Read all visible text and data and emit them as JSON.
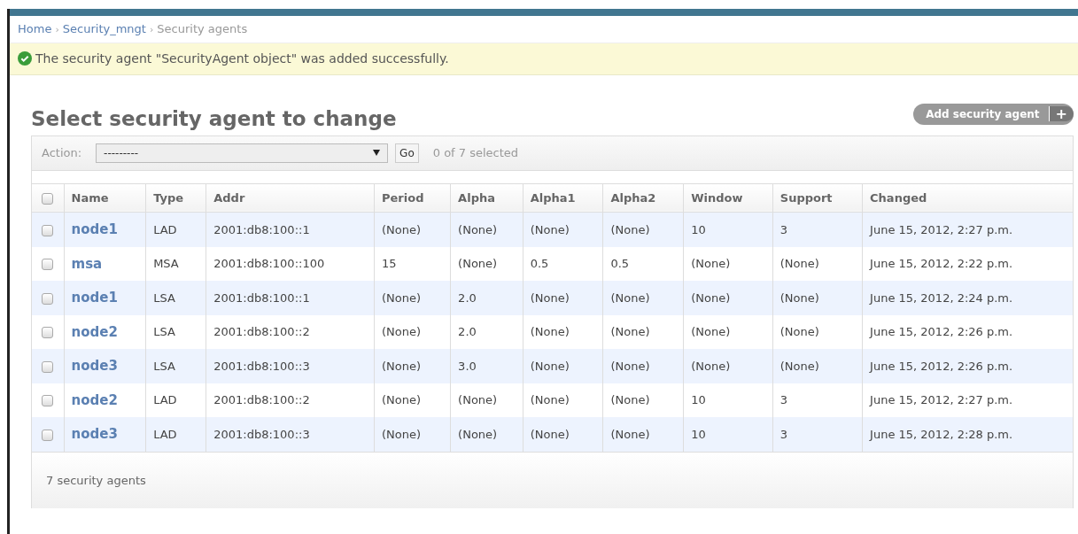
{
  "breadcrumbs": [
    {
      "label": "Home",
      "link": true
    },
    {
      "label": "Security_mngt",
      "link": true
    },
    {
      "label": "Security agents",
      "link": false
    }
  ],
  "breadcrumb_separator": "›",
  "message": {
    "kind": "success",
    "text": "The security agent \"SecurityAgent object\" was added successfully."
  },
  "title": "Select security agent to change",
  "add_button": {
    "label": "Add security agent",
    "icon": "+"
  },
  "actions": {
    "label": "Action:",
    "value": "---------",
    "go": "Go",
    "counter": "0 of 7 selected"
  },
  "table": {
    "select_all_checked": false,
    "columns": [
      "Name",
      "Type",
      "Addr",
      "Period",
      "Alpha",
      "Alpha1",
      "Alpha2",
      "Window",
      "Support",
      "Changed"
    ],
    "rows": [
      {
        "selected": false,
        "cells": [
          "node1",
          "LAD",
          "2001:db8:100::1",
          "(None)",
          "(None)",
          "(None)",
          "(None)",
          "10",
          "3",
          "June 15, 2012, 2:27 p.m."
        ]
      },
      {
        "selected": false,
        "cells": [
          "msa",
          "MSA",
          "2001:db8:100::100",
          "15",
          "(None)",
          "0.5",
          "0.5",
          "(None)",
          "(None)",
          "June 15, 2012, 2:22 p.m."
        ]
      },
      {
        "selected": false,
        "cells": [
          "node1",
          "LSA",
          "2001:db8:100::1",
          "(None)",
          "2.0",
          "(None)",
          "(None)",
          "(None)",
          "(None)",
          "June 15, 2012, 2:24 p.m."
        ]
      },
      {
        "selected": false,
        "cells": [
          "node2",
          "LSA",
          "2001:db8:100::2",
          "(None)",
          "2.0",
          "(None)",
          "(None)",
          "(None)",
          "(None)",
          "June 15, 2012, 2:26 p.m."
        ]
      },
      {
        "selected": false,
        "cells": [
          "node3",
          "LSA",
          "2001:db8:100::3",
          "(None)",
          "3.0",
          "(None)",
          "(None)",
          "(None)",
          "(None)",
          "June 15, 2012, 2:26 p.m."
        ]
      },
      {
        "selected": false,
        "cells": [
          "node2",
          "LAD",
          "2001:db8:100::2",
          "(None)",
          "(None)",
          "(None)",
          "(None)",
          "10",
          "3",
          "June 15, 2012, 2:27 p.m."
        ]
      },
      {
        "selected": false,
        "cells": [
          "node3",
          "LAD",
          "2001:db8:100::3",
          "(None)",
          "(None)",
          "(None)",
          "(None)",
          "10",
          "3",
          "June 15, 2012, 2:28 p.m."
        ]
      }
    ]
  },
  "footer": "7 security agents"
}
